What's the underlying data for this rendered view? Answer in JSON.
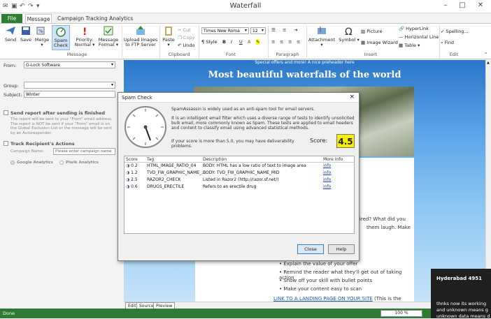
{
  "window": {
    "title": "Waterfall"
  },
  "tabs": {
    "file": "File",
    "message": "Message",
    "campaign": "Campaign Tracking Analytics"
  },
  "ribbon": {
    "send": "Send",
    "save": "Save",
    "merge": "Merge",
    "spam_check": "Spam Check",
    "priority": "Priority: Normal",
    "message_format": "Message Format",
    "upload": "Upload Images to FTP Server",
    "paste": "Paste",
    "cut": "Cut",
    "copy": "Copy",
    "undo": "Undo",
    "style": "Style",
    "font_name": "Times New Roma",
    "font_size": "12",
    "attachment": "Attachment",
    "symbol": "Symbol",
    "picture": "Picture",
    "image_wizard": "Image Wizard",
    "hyperlink": "HyperLink",
    "horizontal_line": "Horizontal Line",
    "table": "Table",
    "spelling": "Spelling...",
    "find": "Find",
    "groups": {
      "message": "Message",
      "clipboard": "Clipboard",
      "font": "Font",
      "paragraph": "Paragraph",
      "insert": "Insert",
      "edit": "Edit"
    }
  },
  "left": {
    "from_label": "From:",
    "from_value": "G-Lock Software",
    "group_label": "Group:",
    "group_value": "",
    "subject_label": "Subject:",
    "subject_value": "Winter",
    "send_report": "Send report after sending is finished",
    "report_note": "The report will be sent to your \"From\" email address. The report is NOT be sent if your \"From\" email is on the Global Exclusion List or the message will be sent by an Autoresponder.",
    "track": "Track Recipient's Actions",
    "campaign_label": "Campaign Name:",
    "campaign_placeholder": "Please enter campaign name",
    "google": "Google Analytics",
    "piwik": "Piwik Analytics"
  },
  "email": {
    "preheader": "Special offers and more! A nice preheader here",
    "title": "Most beautiful waterfalls of the world",
    "side1": "ired? What did you",
    "side2": "them laugh. Make",
    "bullets": [
      "Explain the value of your offer",
      "Remind the reader what they'll get out of taking action",
      "Show off your skill with bullet points",
      "Make your content easy to scan"
    ],
    "link": "LINK TO A LANDING PAGE ON YOUR SITE",
    "link_note": "(This is the really important part.)"
  },
  "bottom_tabs": [
    "Edit",
    "Source",
    "Preview"
  ],
  "status": {
    "left": "Done",
    "zoom": "100 %"
  },
  "dialog": {
    "title": "Spam Check",
    "line1": "SpamAssassin is widely used as an anti-spam tool for email servers.",
    "line2": "It is an intelligent email filter which uses a diverse range of tests to identify unsolicited bulk email, more commonly known as Spam. These tests are applied to email headers and content to classify email using advanced statistical methods.",
    "line3": "If your score is more than 5.0, you may have deliverability problems.",
    "score_label": "Score:",
    "score": "4.5",
    "columns": [
      "Score",
      "Tag",
      "Description",
      "More Info"
    ],
    "rows": [
      {
        "score": "0.2",
        "tag": "HTML_IMAGE_RATIO_04",
        "desc": "BODY: HTML has a low ratio of text to image area",
        "info": "info"
      },
      {
        "score": "1.2",
        "tag": "TVD_FW_GRAPHIC_NAME_...",
        "desc": "BODY: TVD_FW_GRAPHIC_NAME_MID",
        "info": "info"
      },
      {
        "score": "2.5",
        "tag": "RAZOR2_CHECK",
        "desc": "Listed in Razor2 (http://razor.sf.net/)",
        "info": "info"
      },
      {
        "score": "0.6",
        "tag": "DRUGS_ERECTILE",
        "desc": "Refers to an erectile drug",
        "info": "info"
      }
    ],
    "close": "Close",
    "help": "Help"
  },
  "toast": {
    "title": "Hyderabad 4951",
    "line1": "thnks now its working",
    "line2": "and unknown means g",
    "line3": "unknown data means d"
  }
}
